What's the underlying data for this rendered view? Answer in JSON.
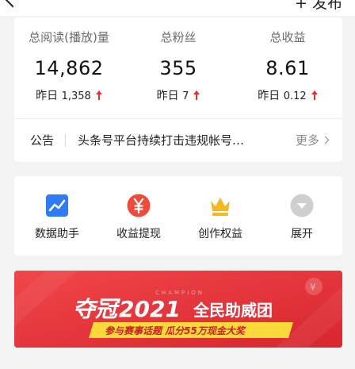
{
  "header": {
    "publish_label": "+ 发布"
  },
  "stats": [
    {
      "label": "总阅读(播放)量",
      "value": "14,862",
      "delta_prefix": "昨日",
      "delta_value": "1,358"
    },
    {
      "label": "总粉丝",
      "value": "355",
      "delta_prefix": "昨日",
      "delta_value": "7"
    },
    {
      "label": "总收益",
      "value": "8.61",
      "delta_prefix": "昨日",
      "delta_value": "0.12"
    }
  ],
  "notice": {
    "label": "公告",
    "text": "头条号平台持续打击违规帐号…",
    "more": "更多"
  },
  "tools": [
    {
      "label": "数据助手",
      "icon": "chart-icon",
      "color": "#2f7bf5"
    },
    {
      "label": "收益提现",
      "icon": "yuan-icon",
      "color": "#ef4a3a"
    },
    {
      "label": "创作权益",
      "icon": "crown-icon",
      "color": "#f5b820"
    },
    {
      "label": "展开",
      "icon": "chevron-down-icon",
      "color": "#c9c9c9"
    }
  ],
  "banner": {
    "word_champion": "CHAMPION",
    "title_a": "夺冠",
    "title_b": "2021",
    "title_c": "全民助威团",
    "subtitle": "参与赛事话题 瓜分55万现金大奖",
    "yuan_symbol": "¥"
  }
}
